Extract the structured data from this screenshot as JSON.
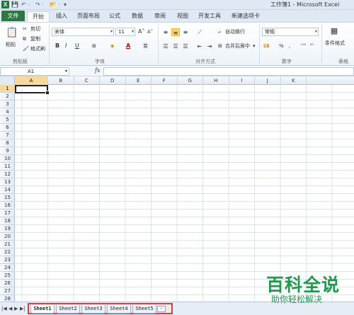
{
  "window": {
    "title": "工作簿1 - Microsoft Excel",
    "app_icon": "X"
  },
  "quick_access": {
    "save": "💾",
    "undo": "↶ ·",
    "redo": "↷ ·",
    "open": "📂 ·",
    "customize": "▾"
  },
  "ribbon_tabs": {
    "file": "文件",
    "items": [
      "开始",
      "插入",
      "页面布局",
      "公式",
      "数据",
      "审阅",
      "视图",
      "开发工具",
      "新建选项卡"
    ],
    "active": "开始"
  },
  "clipboard": {
    "paste": "粘贴",
    "cut": "剪切",
    "copy": "复制",
    "format_painter": "格式刷",
    "label": "剪贴板"
  },
  "font": {
    "name": "宋体",
    "size": "11",
    "grow": "A˄",
    "shrink": "A˅",
    "bold": "B",
    "italic": "I",
    "underline": "U",
    "border": "⊞",
    "fill": "◆",
    "color": "A",
    "wen": "变",
    "label": "字体"
  },
  "alignment": {
    "wrap": "自动换行",
    "merge": "合并后居中",
    "label": "对齐方式"
  },
  "number": {
    "format": "常规",
    "percent": "%",
    "comma": ",",
    "label": "数字"
  },
  "styles": {
    "cond": "条件格式",
    "label": "表格"
  },
  "formula_bar": {
    "name_box": "A1",
    "fx": "fx",
    "value": ""
  },
  "columns": [
    "A",
    "B",
    "C",
    "D",
    "E",
    "F",
    "G",
    "H",
    "I",
    "J",
    "K"
  ],
  "rows": [
    "1",
    "2",
    "3",
    "4",
    "5",
    "6",
    "7",
    "8",
    "9",
    "10",
    "11",
    "12",
    "13",
    "14",
    "15",
    "16",
    "17",
    "18",
    "19",
    "20",
    "21",
    "22",
    "23",
    "24",
    "25",
    "26",
    "27",
    "28"
  ],
  "sheet_nav": [
    "|◀",
    "◀",
    "▶",
    "▶|"
  ],
  "sheets": [
    "Sheet1",
    "Sheet2",
    "Sheet3",
    "Sheet4",
    "Sheet5"
  ],
  "active_sheet": "Sheet1",
  "new_sheet_icon": "+",
  "watermark": {
    "logo": "百科全说",
    "sub": "助你轻松解决"
  },
  "colors": {
    "file_tab": "#2a7a3f",
    "outline": "#e33b3b",
    "watermark": "#1f9a4a",
    "active_header": "#f9d99a"
  }
}
